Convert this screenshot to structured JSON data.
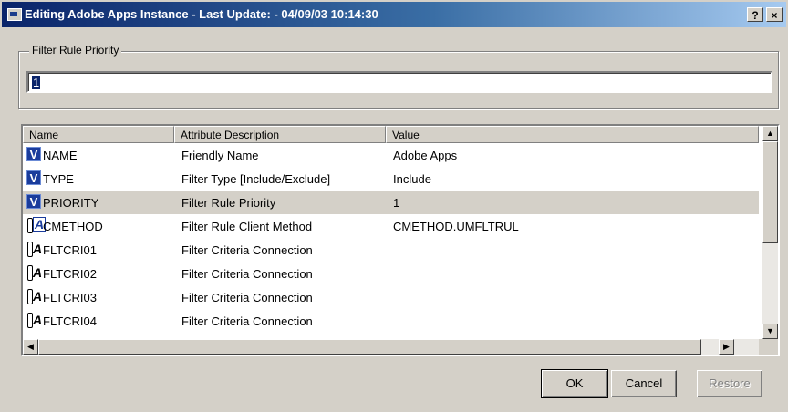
{
  "window": {
    "title": "Editing Adobe Apps Instance - Last Update: - 04/09/03 10:14:30",
    "help_label": "?",
    "close_label": "×"
  },
  "group": {
    "label": "Filter Rule Priority",
    "input_value": "1"
  },
  "list": {
    "columns": [
      "Name",
      "Attribute Description",
      "Value"
    ],
    "rows": [
      {
        "icon": "variable-icon",
        "name": "NAME",
        "desc": "Friendly Name",
        "value": "Adobe Apps"
      },
      {
        "icon": "variable-icon",
        "name": "TYPE",
        "desc": "Filter Type [Include/Exclude]",
        "value": "Include"
      },
      {
        "icon": "variable-icon",
        "name": "PRIORITY",
        "desc": "Filter Rule Priority",
        "value": "1"
      },
      {
        "icon": "method-icon",
        "name": "CMETHOD",
        "desc": "Filter Rule Client Method",
        "value": "CMETHOD.UMFLTRUL"
      },
      {
        "icon": "connection-icon",
        "name": "FLTCRI01",
        "desc": "Filter Criteria Connection",
        "value": ""
      },
      {
        "icon": "connection-icon",
        "name": "FLTCRI02",
        "desc": "Filter Criteria Connection",
        "value": ""
      },
      {
        "icon": "connection-icon",
        "name": "FLTCRI03",
        "desc": "Filter Criteria Connection",
        "value": ""
      },
      {
        "icon": "connection-icon",
        "name": "FLTCRI04",
        "desc": "Filter Criteria Connection",
        "value": ""
      }
    ],
    "selected_row": "PRIORITY"
  },
  "buttons": {
    "ok": "OK",
    "cancel": "Cancel",
    "restore": "Restore"
  },
  "colors": {
    "title_bar": "#0a246a",
    "dialog_face": "#d4d0c8",
    "variable_icon": "#1a3c9c"
  }
}
